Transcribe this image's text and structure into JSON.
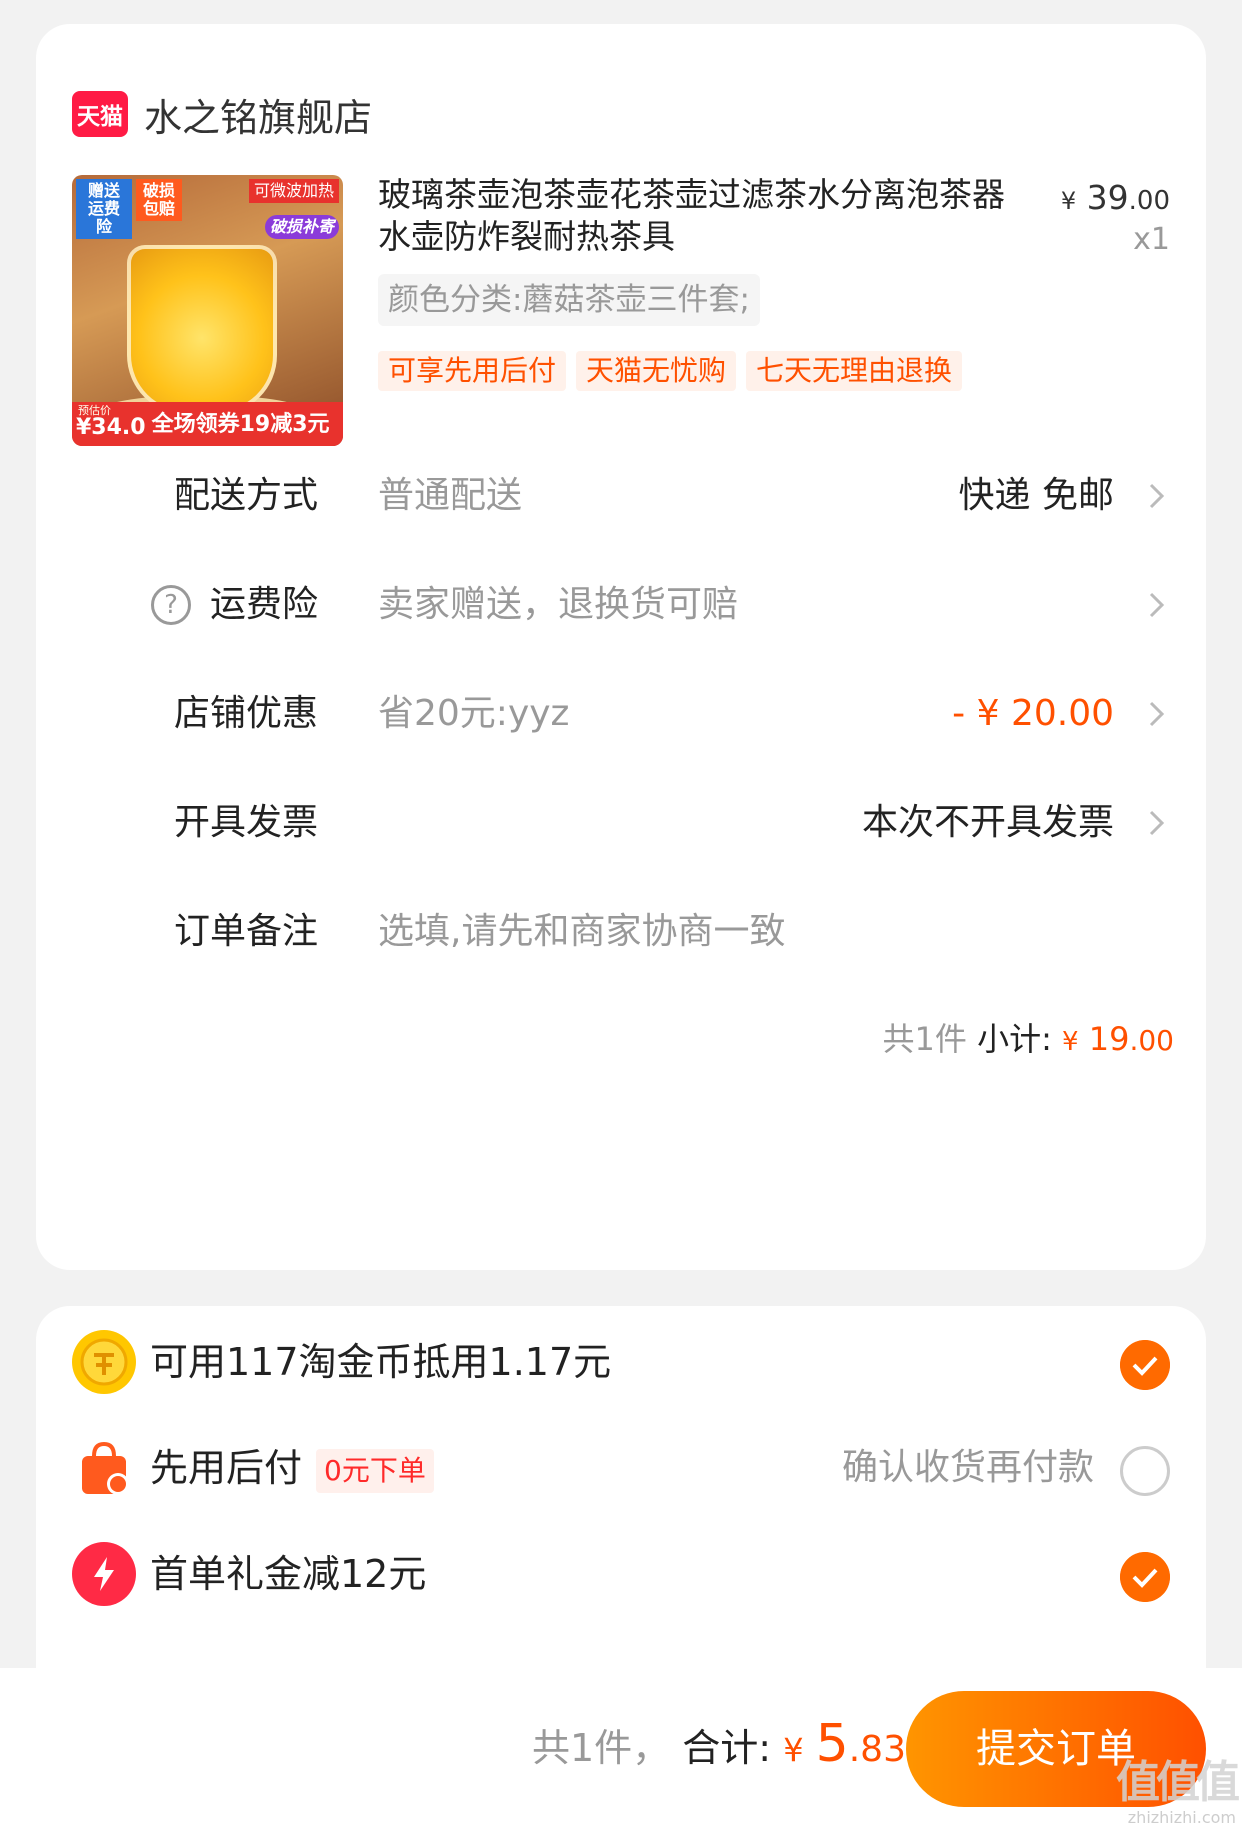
{
  "store": {
    "badge": "天猫",
    "name": "水之铭旗舰店"
  },
  "product": {
    "image_tags": {
      "t1": "赠送运费险",
      "t2": "破损包赔",
      "t3": "可微波加热",
      "t4": "破损补寄"
    },
    "image_bottom": {
      "label": "预估价",
      "price": "¥34.0",
      "promo": "全场领券19减3元"
    },
    "title": "玻璃茶壶泡茶壶花茶壶过滤茶水分离泡茶器水壶防炸裂耐热茶具",
    "price_symbol": "¥",
    "price_int": "39",
    "price_dec": ".00",
    "quantity": "x1",
    "spec": "颜色分类:蘑菇茶壶三件套;",
    "tags": [
      "可享先用后付",
      "天猫无忧购",
      "七天无理由退换"
    ]
  },
  "rows": {
    "delivery": {
      "label": "配送方式",
      "hint": "普通配送",
      "value": "快递 免邮"
    },
    "insurance": {
      "label": "运费险",
      "hint": "卖家赠送，退换货可赔"
    },
    "discount": {
      "label": "店铺优惠",
      "hint": "省20元:yyz",
      "value": "- ¥ 20.00"
    },
    "invoice": {
      "label": "开具发票",
      "value": "本次不开具发票"
    },
    "note": {
      "label": "订单备注",
      "placeholder": "选填,请先和商家协商一致"
    }
  },
  "subtotal": {
    "count": "共1件",
    "label": "小计:",
    "symbol": "¥",
    "int": "19",
    "dec": ".00"
  },
  "payment_options": {
    "coins": {
      "text": "可用117淘金币抵用1.17元",
      "checked": true
    },
    "paylater": {
      "text": "先用后付",
      "chip": "0元下单",
      "right": "确认收货再付款",
      "checked": false
    },
    "gift": {
      "text": "首单礼金减12元",
      "checked": true
    }
  },
  "footer": {
    "count": "共1件，",
    "label": "合计:",
    "symbol": "¥",
    "int": "5",
    "dec": ".83",
    "submit": "提交订单"
  },
  "watermark": {
    "big": "值值值",
    "small": "zhizhizhi.com"
  },
  "colors": {
    "accent": "#ff5000",
    "tmall": "#ff1b45",
    "check": "#ff6a00"
  }
}
